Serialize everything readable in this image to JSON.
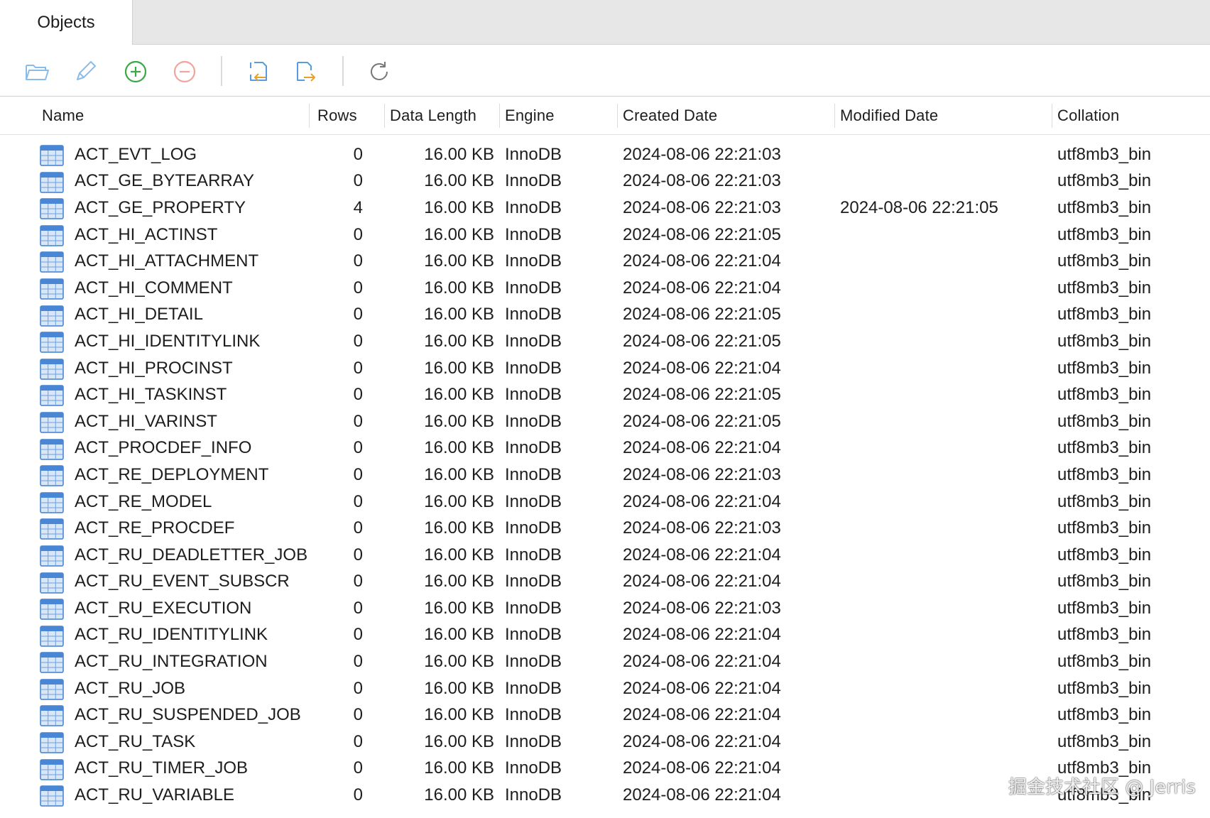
{
  "tabs": [
    {
      "label": "Objects"
    }
  ],
  "toolbar": {
    "buttons": [
      {
        "icon": "folder-open-icon"
      },
      {
        "icon": "pencil-icon"
      },
      {
        "icon": "plus-circle-icon"
      },
      {
        "icon": "minus-circle-icon"
      },
      {
        "icon": "import-icon"
      },
      {
        "icon": "export-icon"
      },
      {
        "icon": "refresh-icon"
      }
    ]
  },
  "table": {
    "columns": [
      "Name",
      "Rows",
      "Data Length",
      "Engine",
      "Created Date",
      "Modified Date",
      "Collation"
    ],
    "rows": [
      {
        "name": "ACT_EVT_LOG",
        "rows": "0",
        "data_length": "16.00 KB",
        "engine": "InnoDB",
        "created": "2024-08-06 22:21:03",
        "modified": "",
        "collation": "utf8mb3_bin"
      },
      {
        "name": "ACT_GE_BYTEARRAY",
        "rows": "0",
        "data_length": "16.00 KB",
        "engine": "InnoDB",
        "created": "2024-08-06 22:21:03",
        "modified": "",
        "collation": "utf8mb3_bin"
      },
      {
        "name": "ACT_GE_PROPERTY",
        "rows": "4",
        "data_length": "16.00 KB",
        "engine": "InnoDB",
        "created": "2024-08-06 22:21:03",
        "modified": "2024-08-06 22:21:05",
        "collation": "utf8mb3_bin"
      },
      {
        "name": "ACT_HI_ACTINST",
        "rows": "0",
        "data_length": "16.00 KB",
        "engine": "InnoDB",
        "created": "2024-08-06 22:21:05",
        "modified": "",
        "collation": "utf8mb3_bin"
      },
      {
        "name": "ACT_HI_ATTACHMENT",
        "rows": "0",
        "data_length": "16.00 KB",
        "engine": "InnoDB",
        "created": "2024-08-06 22:21:04",
        "modified": "",
        "collation": "utf8mb3_bin"
      },
      {
        "name": "ACT_HI_COMMENT",
        "rows": "0",
        "data_length": "16.00 KB",
        "engine": "InnoDB",
        "created": "2024-08-06 22:21:04",
        "modified": "",
        "collation": "utf8mb3_bin"
      },
      {
        "name": "ACT_HI_DETAIL",
        "rows": "0",
        "data_length": "16.00 KB",
        "engine": "InnoDB",
        "created": "2024-08-06 22:21:05",
        "modified": "",
        "collation": "utf8mb3_bin"
      },
      {
        "name": "ACT_HI_IDENTITYLINK",
        "rows": "0",
        "data_length": "16.00 KB",
        "engine": "InnoDB",
        "created": "2024-08-06 22:21:05",
        "modified": "",
        "collation": "utf8mb3_bin"
      },
      {
        "name": "ACT_HI_PROCINST",
        "rows": "0",
        "data_length": "16.00 KB",
        "engine": "InnoDB",
        "created": "2024-08-06 22:21:04",
        "modified": "",
        "collation": "utf8mb3_bin"
      },
      {
        "name": "ACT_HI_TASKINST",
        "rows": "0",
        "data_length": "16.00 KB",
        "engine": "InnoDB",
        "created": "2024-08-06 22:21:05",
        "modified": "",
        "collation": "utf8mb3_bin"
      },
      {
        "name": "ACT_HI_VARINST",
        "rows": "0",
        "data_length": "16.00 KB",
        "engine": "InnoDB",
        "created": "2024-08-06 22:21:05",
        "modified": "",
        "collation": "utf8mb3_bin"
      },
      {
        "name": "ACT_PROCDEF_INFO",
        "rows": "0",
        "data_length": "16.00 KB",
        "engine": "InnoDB",
        "created": "2024-08-06 22:21:04",
        "modified": "",
        "collation": "utf8mb3_bin"
      },
      {
        "name": "ACT_RE_DEPLOYMENT",
        "rows": "0",
        "data_length": "16.00 KB",
        "engine": "InnoDB",
        "created": "2024-08-06 22:21:03",
        "modified": "",
        "collation": "utf8mb3_bin"
      },
      {
        "name": "ACT_RE_MODEL",
        "rows": "0",
        "data_length": "16.00 KB",
        "engine": "InnoDB",
        "created": "2024-08-06 22:21:04",
        "modified": "",
        "collation": "utf8mb3_bin"
      },
      {
        "name": "ACT_RE_PROCDEF",
        "rows": "0",
        "data_length": "16.00 KB",
        "engine": "InnoDB",
        "created": "2024-08-06 22:21:03",
        "modified": "",
        "collation": "utf8mb3_bin"
      },
      {
        "name": "ACT_RU_DEADLETTER_JOB",
        "rows": "0",
        "data_length": "16.00 KB",
        "engine": "InnoDB",
        "created": "2024-08-06 22:21:04",
        "modified": "",
        "collation": "utf8mb3_bin"
      },
      {
        "name": "ACT_RU_EVENT_SUBSCR",
        "rows": "0",
        "data_length": "16.00 KB",
        "engine": "InnoDB",
        "created": "2024-08-06 22:21:04",
        "modified": "",
        "collation": "utf8mb3_bin"
      },
      {
        "name": "ACT_RU_EXECUTION",
        "rows": "0",
        "data_length": "16.00 KB",
        "engine": "InnoDB",
        "created": "2024-08-06 22:21:03",
        "modified": "",
        "collation": "utf8mb3_bin"
      },
      {
        "name": "ACT_RU_IDENTITYLINK",
        "rows": "0",
        "data_length": "16.00 KB",
        "engine": "InnoDB",
        "created": "2024-08-06 22:21:04",
        "modified": "",
        "collation": "utf8mb3_bin"
      },
      {
        "name": "ACT_RU_INTEGRATION",
        "rows": "0",
        "data_length": "16.00 KB",
        "engine": "InnoDB",
        "created": "2024-08-06 22:21:04",
        "modified": "",
        "collation": "utf8mb3_bin"
      },
      {
        "name": "ACT_RU_JOB",
        "rows": "0",
        "data_length": "16.00 KB",
        "engine": "InnoDB",
        "created": "2024-08-06 22:21:04",
        "modified": "",
        "collation": "utf8mb3_bin"
      },
      {
        "name": "ACT_RU_SUSPENDED_JOB",
        "rows": "0",
        "data_length": "16.00 KB",
        "engine": "InnoDB",
        "created": "2024-08-06 22:21:04",
        "modified": "",
        "collation": "utf8mb3_bin"
      },
      {
        "name": "ACT_RU_TASK",
        "rows": "0",
        "data_length": "16.00 KB",
        "engine": "InnoDB",
        "created": "2024-08-06 22:21:04",
        "modified": "",
        "collation": "utf8mb3_bin"
      },
      {
        "name": "ACT_RU_TIMER_JOB",
        "rows": "0",
        "data_length": "16.00 KB",
        "engine": "InnoDB",
        "created": "2024-08-06 22:21:04",
        "modified": "",
        "collation": "utf8mb3_bin"
      },
      {
        "name": "ACT_RU_VARIABLE",
        "rows": "0",
        "data_length": "16.00 KB",
        "engine": "InnoDB",
        "created": "2024-08-06 22:21:04",
        "modified": "",
        "collation": "utf8mb3_bin"
      }
    ]
  },
  "watermark": "掘金技术社区 @ Jerris",
  "colors": {
    "table_icon": "#4a86d6",
    "add_green": "#3aa845",
    "remove_red": "#e8756a",
    "toolbar_blue": "#5a9be0"
  }
}
